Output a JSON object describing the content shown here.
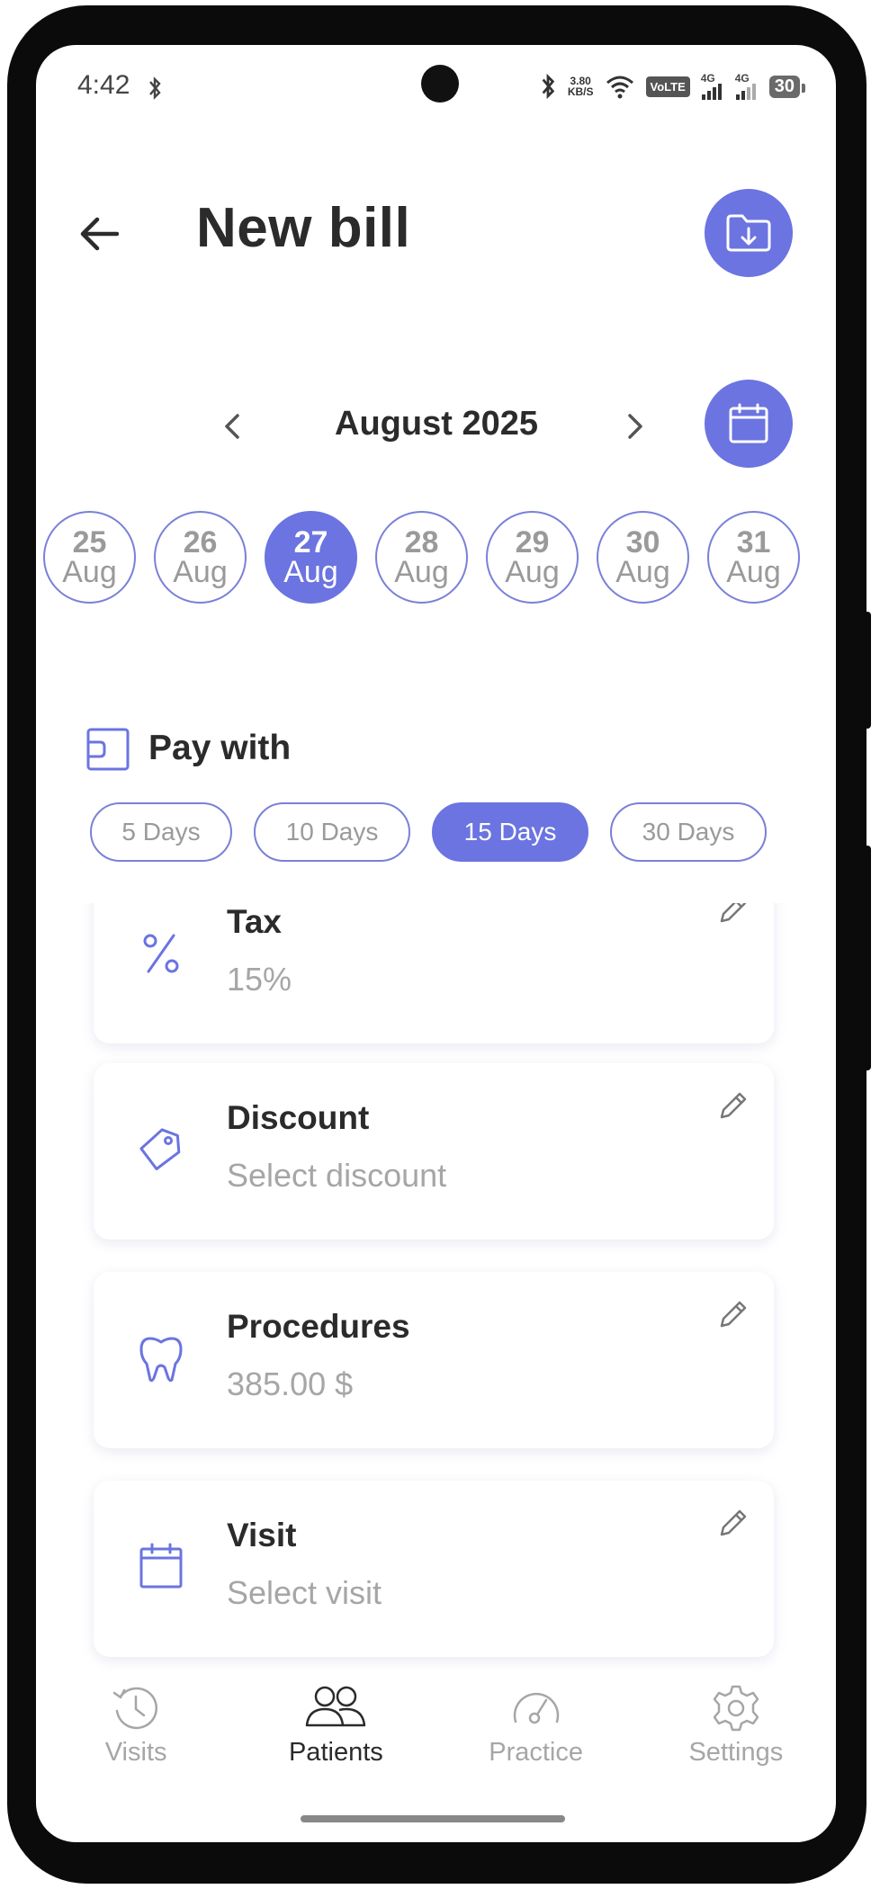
{
  "status_bar": {
    "time": "4:42",
    "net_speed_value": "3.80",
    "net_speed_unit": "KB/S",
    "volte": "VoLTE",
    "sim1_label": "4G",
    "sim2_label": "4G",
    "battery": "30"
  },
  "header": {
    "title": "New bill"
  },
  "calendar": {
    "month_label": "August 2025",
    "days": [
      {
        "num": "25",
        "mon": "Aug",
        "selected": false
      },
      {
        "num": "26",
        "mon": "Aug",
        "selected": false
      },
      {
        "num": "27",
        "mon": "Aug",
        "selected": true
      },
      {
        "num": "28",
        "mon": "Aug",
        "selected": false
      },
      {
        "num": "29",
        "mon": "Aug",
        "selected": false
      },
      {
        "num": "30",
        "mon": "Aug",
        "selected": false
      },
      {
        "num": "31",
        "mon": "Aug",
        "selected": false
      }
    ]
  },
  "pay_with": {
    "label": "Pay with",
    "terms": [
      {
        "label": "5 Days",
        "selected": false
      },
      {
        "label": "10 Days",
        "selected": false
      },
      {
        "label": "15 Days",
        "selected": true
      },
      {
        "label": "30 Days",
        "selected": false
      }
    ]
  },
  "cards": {
    "tax": {
      "title": "Tax",
      "value": "15%",
      "icon": "percent-icon"
    },
    "discount": {
      "title": "Discount",
      "value": "Select discount",
      "icon": "tag-icon"
    },
    "procedures": {
      "title": "Procedures",
      "value": "385.00 $",
      "icon": "tooth-icon"
    },
    "visit": {
      "title": "Visit",
      "value": "Select visit",
      "icon": "calendar-icon"
    }
  },
  "bottom_nav": {
    "items": [
      {
        "label": "Visits",
        "icon": "history-clock-icon",
        "active": false
      },
      {
        "label": "Patients",
        "icon": "users-icon",
        "active": true
      },
      {
        "label": "Practice",
        "icon": "gauge-icon",
        "active": false
      },
      {
        "label": "Settings",
        "icon": "gear-icon",
        "active": false
      }
    ]
  },
  "colors": {
    "accent": "#6b74e0",
    "text_dark": "#2b2b2b",
    "text_muted": "#a6a6a6"
  }
}
